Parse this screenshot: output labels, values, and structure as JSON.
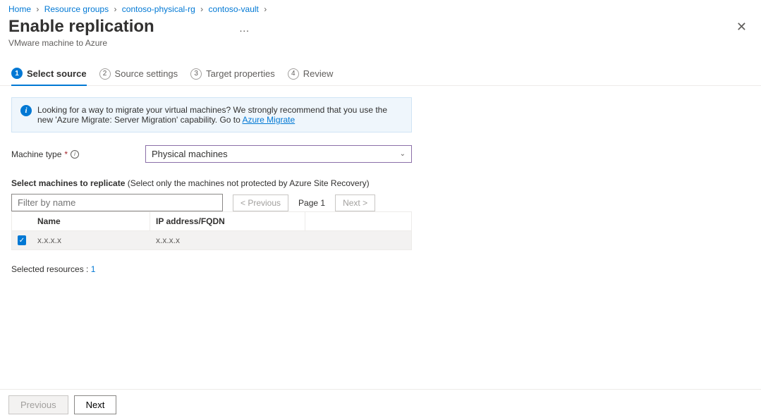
{
  "breadcrumb": {
    "items": [
      "Home",
      "Resource groups",
      "contoso-physical-rg",
      "contoso-vault"
    ]
  },
  "header": {
    "title": "Enable replication",
    "subtitle": "VMware machine to Azure"
  },
  "tabs": [
    {
      "num": "1",
      "label": "Select source",
      "active": true
    },
    {
      "num": "2",
      "label": "Source settings",
      "active": false
    },
    {
      "num": "3",
      "label": "Target properties",
      "active": false
    },
    {
      "num": "4",
      "label": "Review",
      "active": false
    }
  ],
  "infobox": {
    "text": "Looking for a way to migrate your virtual machines? We strongly recommend that you use the new 'Azure Migrate: Server Migration' capability. Go to ",
    "link": "Azure Migrate"
  },
  "machine_type": {
    "label": "Machine type",
    "value": "Physical machines"
  },
  "replicate": {
    "heading_bold": "Select machines to replicate",
    "heading_rest": " (Select only the machines not protected by Azure Site Recovery)",
    "filter_placeholder": "Filter by name",
    "prev": "<  Previous",
    "page": "Page 1",
    "next": "Next  >",
    "columns": {
      "name": "Name",
      "ip": "IP address/FQDN"
    },
    "rows": [
      {
        "checked": true,
        "name": "x.x.x.x",
        "ip": "x.x.x.x"
      }
    ]
  },
  "selected": {
    "label": "Selected resources : ",
    "count": "1"
  },
  "footer": {
    "previous": "Previous",
    "next": "Next"
  }
}
